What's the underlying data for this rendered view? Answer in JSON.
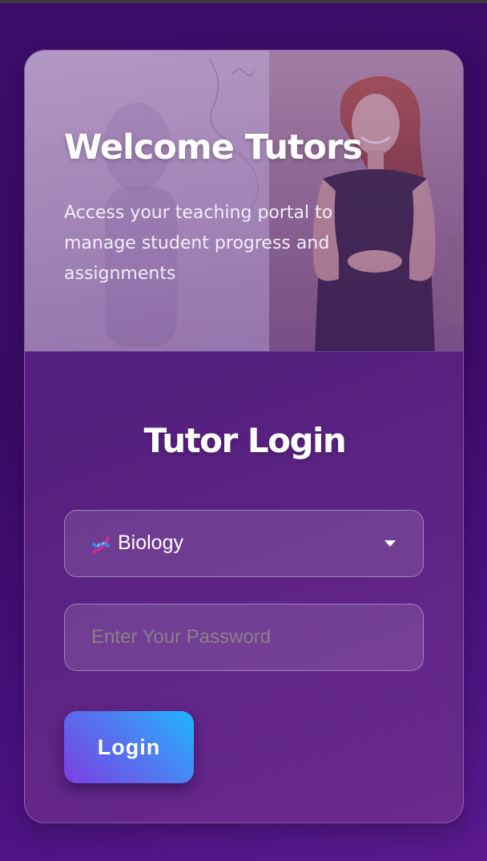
{
  "hero": {
    "title": "Welcome Tutors",
    "subtitle": "Access your teaching portal to manage student progress and assignments"
  },
  "login": {
    "title": "Tutor Login",
    "subject_select": {
      "icon": "dna-icon",
      "selected_value": "Biology"
    },
    "password": {
      "placeholder": "Enter Your Password",
      "value": ""
    },
    "submit_label": "Login"
  },
  "colors": {
    "background": "#3d0d6b",
    "card": "#56207f",
    "button_start": "#7b3fe4",
    "button_end": "#1fb6ff"
  }
}
